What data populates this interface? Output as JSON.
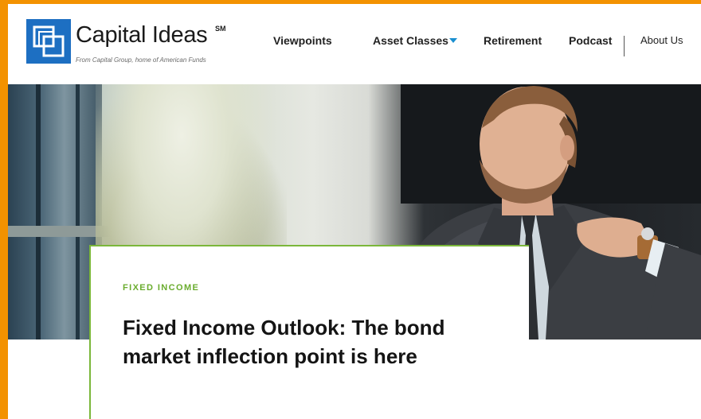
{
  "brand": {
    "name": "Capital Ideas",
    "service_mark": "SM",
    "tagline": "From Capital Group, home of American Funds",
    "colors": {
      "logo_blue": "#1d6fc2",
      "accent_green": "#7bb73a",
      "caret_blue": "#1a8fd0",
      "frame_orange": "#f39200"
    }
  },
  "nav": {
    "items": [
      {
        "label": "Viewpoints"
      },
      {
        "label": "Asset Classes",
        "has_dropdown": true,
        "icon": "chevron-down-icon"
      },
      {
        "label": "Retirement"
      },
      {
        "label": "Podcast"
      },
      {
        "label": "About Us"
      }
    ]
  },
  "hero": {
    "image": "man-in-suit-looking-away"
  },
  "article": {
    "category": "FIXED INCOME",
    "title": "Fixed Income Outlook: The bond market inflection point is here"
  }
}
